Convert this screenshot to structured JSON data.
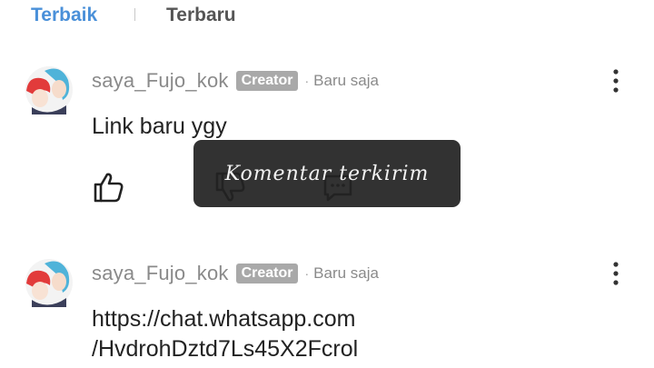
{
  "tabs": {
    "best": "Terbaik",
    "newest": "Terbaru",
    "active": "best"
  },
  "comments": [
    {
      "username": "saya_Fujo_kok",
      "badge": "Creator",
      "separator": "·",
      "time": "Baru saja",
      "text": "Link baru ygy"
    },
    {
      "username": "saya_Fujo_kok",
      "badge": "Creator",
      "separator": "·",
      "time": "Baru saja",
      "text_line1": "https://chat.whatsapp.com",
      "text_line2": "/HvdrohDztd7Ls45X2Fcrol"
    }
  ],
  "toast": {
    "message": "Komentar terkirim"
  },
  "icons": {
    "like": "thumbs-up-icon",
    "dislike": "thumbs-down-icon",
    "reply": "comment-icon",
    "more": "more-vertical-icon"
  },
  "colors": {
    "active_tab": "#4a90d9",
    "inactive_tab": "#555555",
    "badge_bg": "#a9a9a9",
    "meta_text": "#8a8a8a",
    "toast_bg": "#222222"
  }
}
